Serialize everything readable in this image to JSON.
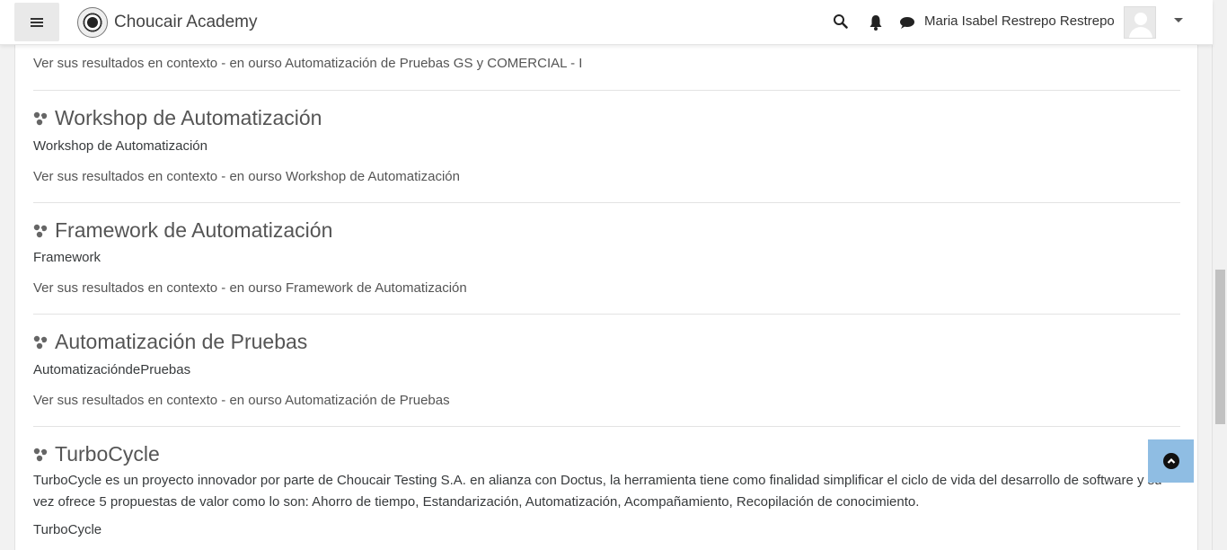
{
  "navbar": {
    "brand_name": "Choucair Academy",
    "user_name": "Maria Isabel Restrepo Restrepo",
    "icons": [
      "search-icon",
      "bell-icon",
      "chat-icon"
    ]
  },
  "results": [
    {
      "context_text": "Ver sus resultados en contexto - en ourso Automatización de Pruebas GS y COMERCIAL - I"
    },
    {
      "title": "Workshop de Automatización",
      "summary": "Workshop de Automatización",
      "context_text": "Ver sus resultados en contexto - en ourso Workshop de Automatización"
    },
    {
      "title": "Framework de Automatización",
      "summary": "Framework",
      "context_text": "Ver sus resultados en contexto - en ourso Framework de Automatización"
    },
    {
      "title": "Automatización de Pruebas",
      "summary": "AutomatizacióndePruebas",
      "context_text": "Ver sus resultados en contexto - en ourso Automatización de Pruebas"
    },
    {
      "title": "TurboCycle",
      "summary": "TurboCycle es un proyecto innovador por parte de Choucair Testing S.A. en alianza con Doctus, la herramienta tiene como finalidad simplificar el ciclo de vida del desarrollo de software y su vez ofrece 5 propuestas de valor como lo son: Ahorro de tiempo, Estandarización, Automatización, Acompañamiento, Recopilación de conocimiento.",
      "summary2": "TurboCycle"
    }
  ],
  "colors": {
    "back_to_top": "#8fbde3",
    "background": "#f2f2f2"
  }
}
